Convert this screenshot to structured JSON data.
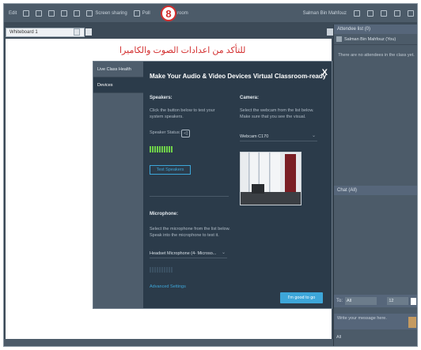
{
  "toolbar": {
    "edit": "Edit",
    "screen_sharing": "Screen sharing",
    "poll": "Poll",
    "room_label": "ll room",
    "user_name": "Salman Bin Mahfouz",
    "step_number": "8"
  },
  "whiteboard": {
    "tab_label": "Whiteboard 1",
    "annotation": "للتأكد من اعدادات الصوت والكاميرا"
  },
  "attendees": {
    "header": "Attendee list (0)",
    "me": "Salman Bin Mahfouz (You)",
    "empty_text": "There are no attendees in the class yet."
  },
  "chat": {
    "header": "Chat (All)",
    "to_label": "To:",
    "to_value": "All",
    "font_size": "12",
    "input_placeholder": "Write your message here.",
    "footer_value": "All"
  },
  "modal": {
    "title": "Make Your Audio & Video Devices Virtual Classroom-ready",
    "close": "X",
    "sidebar": [
      {
        "label": "Live Class Health",
        "active": false
      },
      {
        "label": "Devices",
        "active": true
      }
    ],
    "speakers": {
      "heading": "Speakers:",
      "desc": "Click the button below to test your system speakers.",
      "status_label": "Speaker Status:",
      "test_button": "Test Speakers"
    },
    "camera": {
      "heading": "Camera:",
      "desc": "Select the webcam from the list below. Make sure that you see the visual.",
      "selected": "Webcam C170"
    },
    "microphone": {
      "heading": "Microphone:",
      "desc": "Select the microphone from the list below. Speak into the microphone to test it.",
      "selected": "Headset Microphone (4- Microso...",
      "advanced": "Advanced Settings"
    },
    "good_button": "I'm good to go"
  },
  "colors": {
    "accent": "#3da6d9",
    "annotation_red": "#d32f2f",
    "level_green": "#6fd14a",
    "modal_bg": "#2b3b4a"
  }
}
